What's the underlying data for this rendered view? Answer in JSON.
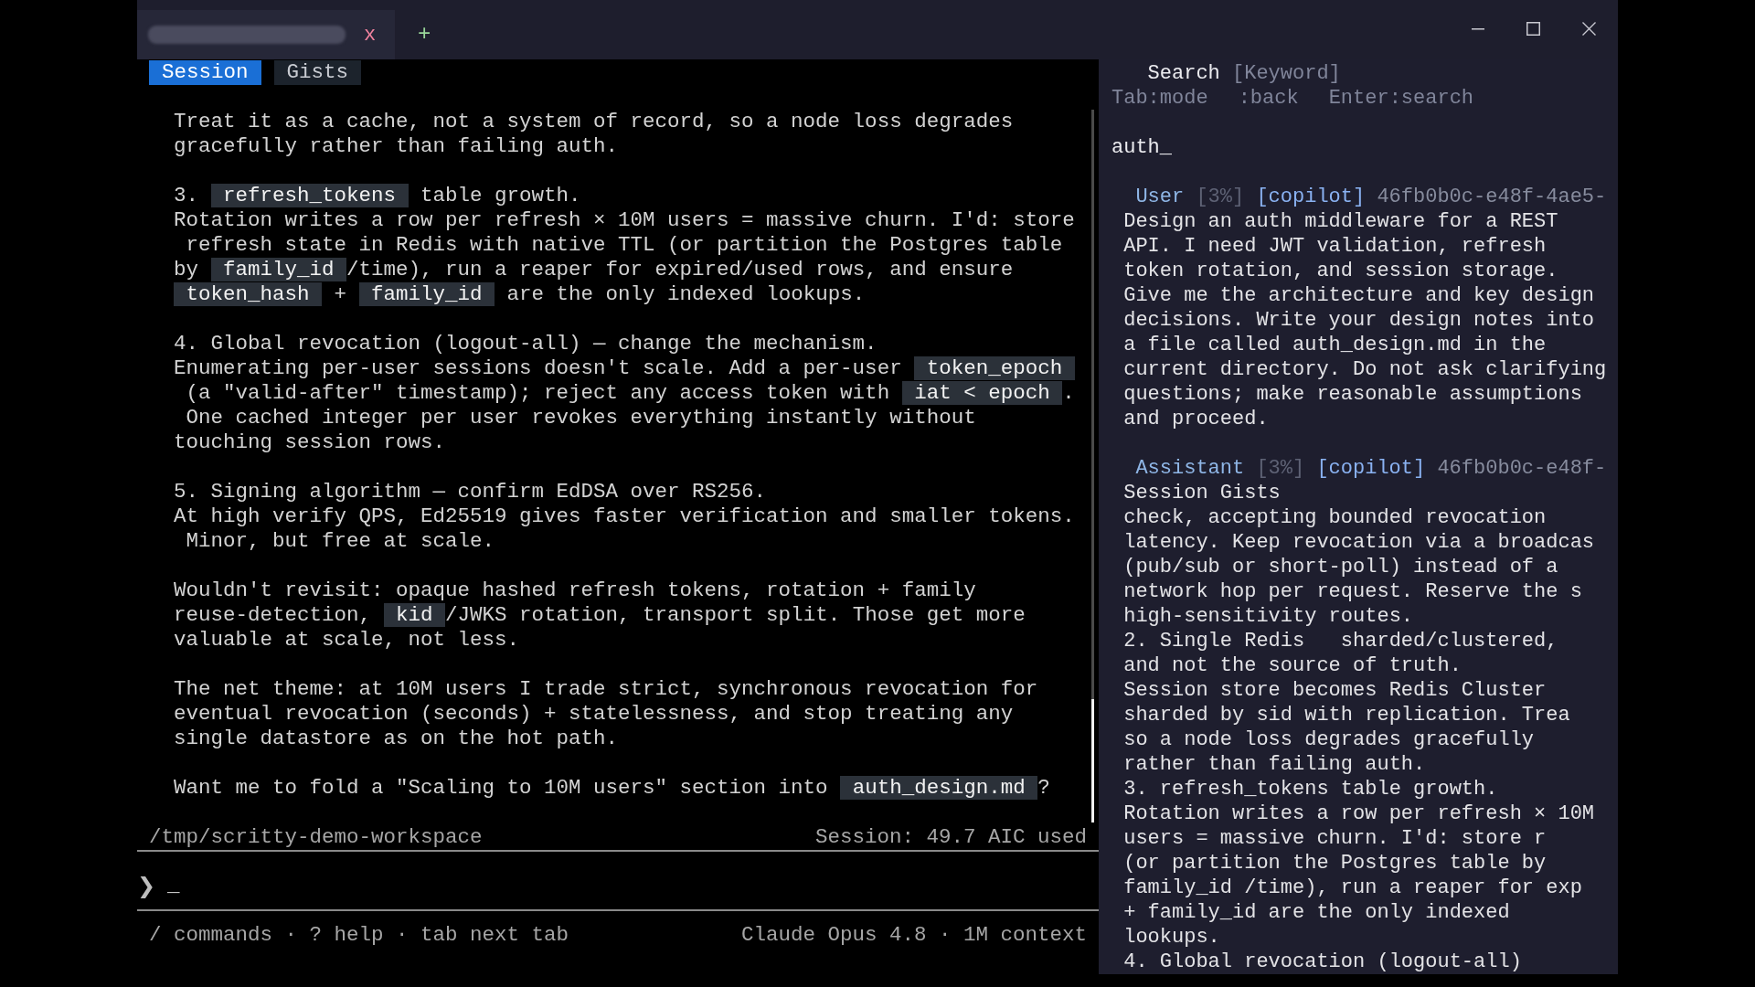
{
  "title_bar": {
    "tabs": [
      {
        "close": "x"
      }
    ],
    "new_tab": "+"
  },
  "pane_tabs": [
    {
      "label": "Session",
      "selected": true
    },
    {
      "label": "Gists",
      "selected": false
    }
  ],
  "transcript": {
    "paragraphs": [
      {
        "lines": [
          [
            {
              "kind": "text",
              "text": "Treat it as a cache, not a system of record, so a node loss degrades"
            }
          ],
          [
            {
              "kind": "text",
              "text": "gracefully rather than failing auth."
            }
          ]
        ]
      },
      {
        "lines": [
          [
            {
              "kind": "text",
              "text": "3. "
            },
            {
              "kind": "code",
              "text": "refresh_tokens"
            },
            {
              "kind": "text",
              "text": " table growth."
            }
          ],
          [
            {
              "kind": "text",
              "text": "Rotation writes a row per refresh × 10M users = massive churn. I'd: store"
            }
          ],
          [
            {
              "kind": "text",
              "text": " refresh state in Redis with native TTL (or partition the Postgres table"
            }
          ],
          [
            {
              "kind": "text",
              "text": "by "
            },
            {
              "kind": "code",
              "text": "family_id"
            },
            {
              "kind": "text",
              "text": "/time), run a reaper for expired/used rows, and ensure"
            }
          ],
          [
            {
              "kind": "code",
              "text": "token_hash"
            },
            {
              "kind": "text",
              "text": " + "
            },
            {
              "kind": "code",
              "text": "family_id"
            },
            {
              "kind": "text",
              "text": " are the only indexed lookups."
            }
          ]
        ]
      },
      {
        "lines": [
          [
            {
              "kind": "text",
              "text": "4. Global revocation (logout-all) — change the mechanism."
            }
          ],
          [
            {
              "kind": "text",
              "text": "Enumerating per-user sessions doesn't scale. Add a per-user "
            },
            {
              "kind": "code",
              "text": "token_epoch"
            }
          ],
          [
            {
              "kind": "text",
              "text": " (a \"valid-after\" timestamp); reject any access token with "
            },
            {
              "kind": "code",
              "text": "iat < epoch"
            },
            {
              "kind": "text",
              "text": "."
            }
          ],
          [
            {
              "kind": "text",
              "text": " One cached integer per user revokes everything instantly without"
            }
          ],
          [
            {
              "kind": "text",
              "text": "touching session rows."
            }
          ]
        ]
      },
      {
        "lines": [
          [
            {
              "kind": "text",
              "text": "5. Signing algorithm — confirm EdDSA over RS256."
            }
          ],
          [
            {
              "kind": "text",
              "text": "At high verify QPS, Ed25519 gives faster verification and smaller tokens."
            }
          ],
          [
            {
              "kind": "text",
              "text": " Minor, but free at scale."
            }
          ]
        ]
      },
      {
        "lines": [
          [
            {
              "kind": "text",
              "text": "Wouldn't revisit: opaque hashed refresh tokens, rotation + family"
            }
          ],
          [
            {
              "kind": "text",
              "text": "reuse-detection, "
            },
            {
              "kind": "code",
              "text": "kid"
            },
            {
              "kind": "text",
              "text": "/JWKS rotation, transport split. Those get more"
            }
          ],
          [
            {
              "kind": "text",
              "text": "valuable at scale, not less."
            }
          ]
        ]
      },
      {
        "lines": [
          [
            {
              "kind": "text",
              "text": "The net theme: at 10M users I trade strict, synchronous revocation for"
            }
          ],
          [
            {
              "kind": "text",
              "text": "eventual revocation (seconds) + statelessness, and stop treating any"
            }
          ],
          [
            {
              "kind": "text",
              "text": "single datastore as on the hot path."
            }
          ]
        ]
      },
      {
        "lines": [
          [
            {
              "kind": "text",
              "text": "Want me to fold a \"Scaling to 10M users\" section into "
            },
            {
              "kind": "code",
              "text": "auth_design.md"
            },
            {
              "kind": "text",
              "text": "?"
            }
          ]
        ]
      }
    ]
  },
  "status_bar": {
    "path": "/tmp/scritty-demo-workspace",
    "usage": "Session: 49.7 AIC used"
  },
  "prompt": {
    "symbol": "❯",
    "cursor": "_"
  },
  "footer": {
    "hints": "/ commands · ? help · tab next tab",
    "model": "Claude Opus 4.8 · 1M context"
  },
  "search_panel": {
    "title": "Search",
    "mode": "[Keyword]",
    "key_hints": [
      "Tab:mode",
      ":back",
      "Enter:search"
    ],
    "query": "auth_",
    "results": [
      {
        "role": "User",
        "score": "[3%]",
        "source": "[copilot]",
        "id": "46fb0b0c-e48f-4ae5-",
        "lines": [
          "Design an auth middleware for a REST",
          "API. I need JWT validation, refresh",
          "token rotation, and session storage.",
          "Give me the architecture and key design",
          "decisions. Write your design notes into",
          "a file called auth_design.md in the",
          "current directory. Do not ask clarifying",
          "questions; make reasonable assumptions",
          "and proceed."
        ]
      },
      {
        "role": "Assistant",
        "score": "[3%]",
        "source": "[copilot]",
        "id": "46fb0b0c-e48f-",
        "lines": [
          "Session Gists",
          "check, accepting bounded revocation",
          "latency. Keep revocation via a broadcas",
          "(pub/sub or short-poll) instead of a",
          "network hop per request. Reserve the s",
          "high-sensitivity routes.",
          "2. Single Redis   sharded/clustered,",
          "and not the source of truth.",
          "Session store becomes Redis Cluster",
          "sharded by sid with replication. Trea",
          "so a node loss degrades gracefully",
          "rather than failing auth.",
          "3. refresh_tokens table growth.",
          "Rotation writes a row per refresh × 10M",
          "users = massive churn. I'd: store r",
          "(or partition the Postgres table by",
          "family_id /time), run a reaper for exp",
          "+ family_id are the only indexed",
          "lookups.",
          "4. Global revocation (logout-all)"
        ]
      }
    ]
  }
}
